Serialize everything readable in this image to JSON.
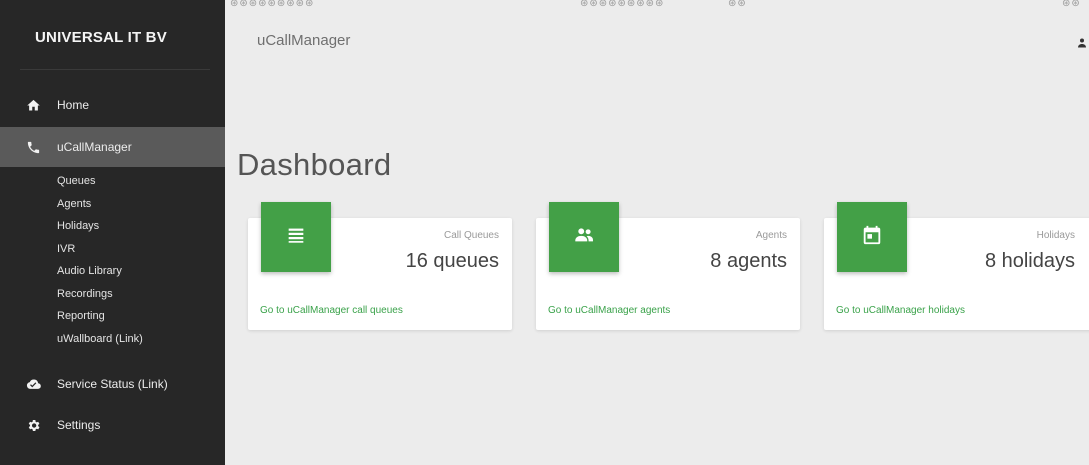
{
  "sidebar": {
    "brand": "UNIVERSAL IT BV",
    "items": [
      {
        "label": "Home",
        "icon": "home-icon"
      },
      {
        "label": "uCallManager",
        "icon": "phone-icon",
        "active": true
      },
      {
        "label": "Service Status (Link)",
        "icon": "cloud-check-icon"
      },
      {
        "label": "Settings",
        "icon": "gear-icon"
      }
    ],
    "subitems": [
      "Queues",
      "Agents",
      "Holidays",
      "IVR",
      "Audio Library",
      "Recordings",
      "Reporting",
      "uWallboard (Link)"
    ]
  },
  "header": {
    "app_title": "uCallManager",
    "user_icon": "user-icon"
  },
  "main": {
    "page_title": "Dashboard",
    "cards": [
      {
        "label": "Call Queues",
        "value": "16 queues",
        "link": "Go to uCallManager call queues",
        "icon": "list-icon"
      },
      {
        "label": "Agents",
        "value": "8 agents",
        "link": "Go to uCallManager agents",
        "icon": "people-icon"
      },
      {
        "label": "Holidays",
        "value": "8 holidays",
        "link": "Go to uCallManager holidays",
        "icon": "calendar-icon"
      }
    ]
  },
  "colors": {
    "sidebar_bg": "#272727",
    "sidebar_active": "#5a5a5a",
    "accent_green": "#43a047",
    "link_green": "#3aa24a",
    "page_bg": "#ececec"
  }
}
